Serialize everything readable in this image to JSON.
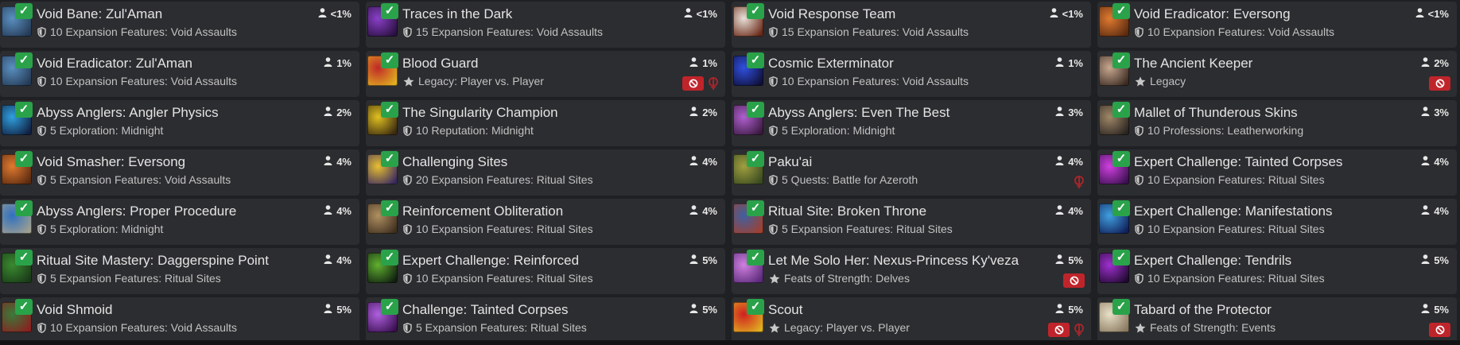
{
  "colors": {
    "check": "#2aa24a",
    "restricted": "#c0242b",
    "horde": "#a3262b"
  },
  "achievements": [
    {
      "title": "Void Bane: Zul'Aman",
      "meta_type": "shield",
      "meta": "10 Expansion Features: Void Assaults",
      "pct": "<1%",
      "badges": [],
      "icon": [
        "#5a90c0",
        "#253a55"
      ]
    },
    {
      "title": "Traces in the Dark",
      "meta_type": "shield",
      "meta": "15 Expansion Features: Void Assaults",
      "pct": "<1%",
      "badges": [],
      "icon": [
        "#8a40c8",
        "#2a1040"
      ]
    },
    {
      "title": "Void Response Team",
      "meta_type": "shield",
      "meta": "15 Expansion Features: Void Assaults",
      "pct": "<1%",
      "badges": [],
      "icon": [
        "#e8e0d8",
        "#6a2a18"
      ]
    },
    {
      "title": "Void Eradicator: Eversong",
      "meta_type": "shield",
      "meta": "10 Expansion Features: Void Assaults",
      "pct": "<1%",
      "badges": [],
      "icon": [
        "#e07a30",
        "#5a2a10"
      ]
    },
    {
      "title": "Void Eradicator: Zul'Aman",
      "meta_type": "shield",
      "meta": "10 Expansion Features: Void Assaults",
      "pct": "1%",
      "badges": [],
      "icon": [
        "#5a90c0",
        "#253a55"
      ]
    },
    {
      "title": "Blood Guard",
      "meta_type": "star",
      "meta": "Legacy: Player vs. Player",
      "pct": "1%",
      "badges": [
        "no",
        "horde"
      ],
      "icon": [
        "#c02828",
        "#e0b020"
      ]
    },
    {
      "title": "Cosmic Exterminator",
      "meta_type": "shield",
      "meta": "10 Expansion Features: Void Assaults",
      "pct": "1%",
      "badges": [],
      "icon": [
        "#3050e0",
        "#10103a"
      ]
    },
    {
      "title": "The Ancient Keeper",
      "meta_type": "star",
      "meta": "Legacy",
      "pct": "2%",
      "badges": [
        "no"
      ],
      "icon": [
        "#c8a890",
        "#3a2a22"
      ]
    },
    {
      "title": "Abyss Anglers: Angler Physics",
      "meta_type": "shield",
      "meta": "5 Exploration: Midnight",
      "pct": "2%",
      "badges": [],
      "icon": [
        "#30a0e0",
        "#102040"
      ]
    },
    {
      "title": "The Singularity Champion",
      "meta_type": "shield",
      "meta": "10 Reputation: Midnight",
      "pct": "2%",
      "badges": [],
      "icon": [
        "#e0c020",
        "#3a2a10"
      ]
    },
    {
      "title": "Abyss Anglers: Even The Best",
      "meta_type": "shield",
      "meta": "5 Exploration: Midnight",
      "pct": "3%",
      "badges": [],
      "icon": [
        "#b060d0",
        "#3a1a40"
      ]
    },
    {
      "title": "Mallet of Thunderous Skins",
      "meta_type": "shield",
      "meta": "10 Professions: Leatherworking",
      "pct": "3%",
      "badges": [],
      "icon": [
        "#a08868",
        "#2a2420"
      ]
    },
    {
      "title": "Void Smasher: Eversong",
      "meta_type": "shield",
      "meta": "5 Expansion Features: Void Assaults",
      "pct": "4%",
      "badges": [],
      "icon": [
        "#e07a30",
        "#5a2a10"
      ]
    },
    {
      "title": "Challenging Sites",
      "meta_type": "shield",
      "meta": "20 Expansion Features: Ritual Sites",
      "pct": "4%",
      "badges": [],
      "icon": [
        "#e8c030",
        "#3a2a60"
      ]
    },
    {
      "title": "Paku'ai",
      "meta_type": "shield",
      "meta": "5 Quests: Battle for Azeroth",
      "pct": "4%",
      "badges": [
        "horde"
      ],
      "icon": [
        "#a0a040",
        "#3a4a20"
      ]
    },
    {
      "title": "Expert Challenge: Tainted Corpses",
      "meta_type": "shield",
      "meta": "10 Expansion Features: Ritual Sites",
      "pct": "4%",
      "badges": [],
      "icon": [
        "#d040e0",
        "#3a1050"
      ]
    },
    {
      "title": "Abyss Anglers: Proper Procedure",
      "meta_type": "shield",
      "meta": "5 Exploration: Midnight",
      "pct": "4%",
      "badges": [],
      "icon": [
        "#3070c0",
        "#a0a090"
      ]
    },
    {
      "title": "Reinforcement Obliteration",
      "meta_type": "shield",
      "meta": "10 Expansion Features: Ritual Sites",
      "pct": "4%",
      "badges": [],
      "icon": [
        "#b09060",
        "#403020"
      ]
    },
    {
      "title": "Ritual Site: Broken Throne",
      "meta_type": "shield",
      "meta": "5 Expansion Features: Ritual Sites",
      "pct": "4%",
      "badges": [],
      "icon": [
        "#4060a0",
        "#a04030"
      ]
    },
    {
      "title": "Expert Challenge: Manifestations",
      "meta_type": "shield",
      "meta": "10 Expansion Features: Ritual Sites",
      "pct": "4%",
      "badges": [],
      "icon": [
        "#40a0e0",
        "#10205a"
      ]
    },
    {
      "title": "Ritual Site Mastery: Daggerspine Point",
      "meta_type": "shield",
      "meta": "5 Expansion Features: Ritual Sites",
      "pct": "4%",
      "badges": [],
      "icon": [
        "#3a8a30",
        "#1a3a18"
      ]
    },
    {
      "title": "Expert Challenge: Reinforced",
      "meta_type": "shield",
      "meta": "10 Expansion Features: Ritual Sites",
      "pct": "5%",
      "badges": [],
      "icon": [
        "#60b030",
        "#102010"
      ]
    },
    {
      "title": "Let Me Solo Her: Nexus-Princess Ky'veza",
      "meta_type": "star",
      "meta": "Feats of Strength: Delves",
      "pct": "5%",
      "badges": [
        "no"
      ],
      "icon": [
        "#d080e0",
        "#5a2a7a"
      ]
    },
    {
      "title": "Expert Challenge: Tendrils",
      "meta_type": "shield",
      "meta": "10 Expansion Features: Ritual Sites",
      "pct": "5%",
      "badges": [],
      "icon": [
        "#a030d0",
        "#200a30"
      ]
    },
    {
      "title": "Void Shmoid",
      "meta_type": "shield",
      "meta": "10 Expansion Features: Void Assaults",
      "pct": "5%",
      "badges": [],
      "icon": [
        "#3a7a3a",
        "#8a2020"
      ]
    },
    {
      "title": "Challenge: Tainted Corpses",
      "meta_type": "shield",
      "meta": "5 Expansion Features: Ritual Sites",
      "pct": "5%",
      "badges": [],
      "icon": [
        "#b060e0",
        "#3a1050"
      ]
    },
    {
      "title": "Scout",
      "meta_type": "star",
      "meta": "Legacy: Player vs. Player",
      "pct": "5%",
      "badges": [
        "no",
        "horde"
      ],
      "icon": [
        "#d02020",
        "#e0b020"
      ]
    },
    {
      "title": "Tabard of the Protector",
      "meta_type": "star",
      "meta": "Feats of Strength: Events",
      "pct": "5%",
      "badges": [
        "no"
      ],
      "icon": [
        "#e8e0c8",
        "#8a7a60"
      ]
    }
  ]
}
